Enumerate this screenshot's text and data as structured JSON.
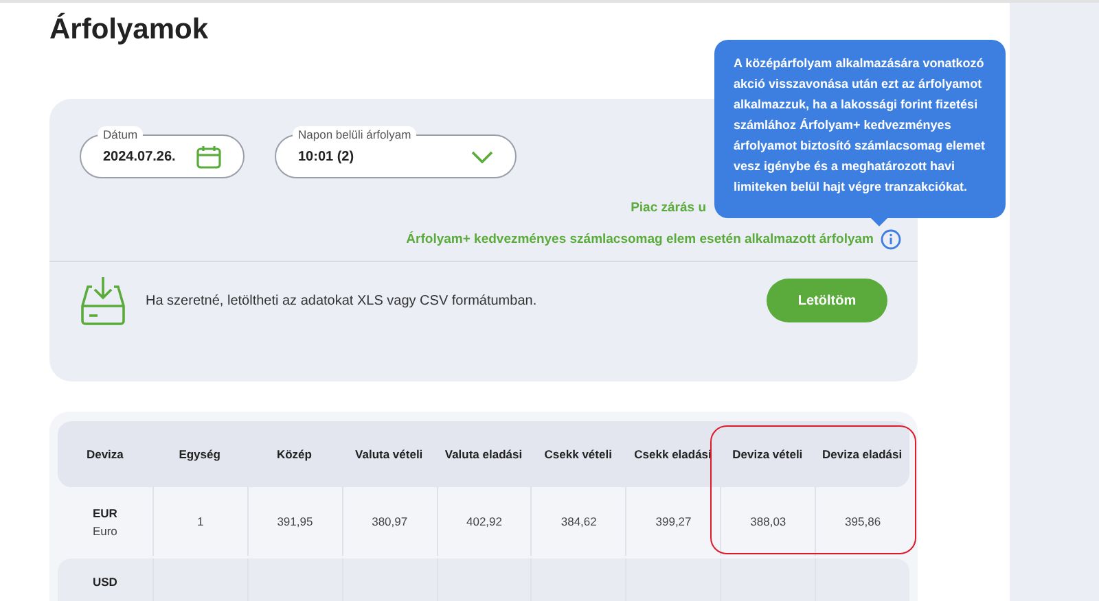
{
  "page": {
    "title": "Árfolyamok"
  },
  "filters": {
    "date": {
      "label": "Dátum",
      "value": "2024.07.26."
    },
    "intraday": {
      "label": "Napon belüli árfolyam",
      "value": "10:01 (2)"
    }
  },
  "notes": [
    "Piac zárás u",
    "Árfolyam+ kedvezményes számlacsomag elem esetén alkalmazott árfolyam"
  ],
  "tooltip": {
    "text": "A középárfolyam alkalmazására vonatkozó akció visszavonása után ezt az árfolyamot alkalmazzuk, ha a lakossági forint fizetési számlához Árfolyam+ kedvezményes árfolyamot biztosító számlacsomag elemet vesz igénybe és a meghatározott havi limiteken belül hajt végre tranzakciókat."
  },
  "download": {
    "text": "Ha szeretné, letöltheti az adatokat XLS vagy CSV formátumban.",
    "button": "Letöltöm"
  },
  "table": {
    "columns": [
      "Deviza",
      "Egység",
      "Közép",
      "Valuta vételi",
      "Valuta eladási",
      "Csekk vételi",
      "Csekk eladási",
      "Deviza vételi",
      "Deviza eladási"
    ],
    "rows": [
      {
        "cells": [
          {
            "text": "EUR",
            "sub": "Euro"
          },
          {
            "text": "1"
          },
          {
            "text": "391,95"
          },
          {
            "text": "380,97"
          },
          {
            "text": "402,92"
          },
          {
            "text": "384,62"
          },
          {
            "text": "399,27"
          },
          {
            "text": "388,03"
          },
          {
            "text": "395,86"
          }
        ]
      },
      {
        "cells": [
          {
            "text": "USD"
          }
        ]
      }
    ]
  }
}
